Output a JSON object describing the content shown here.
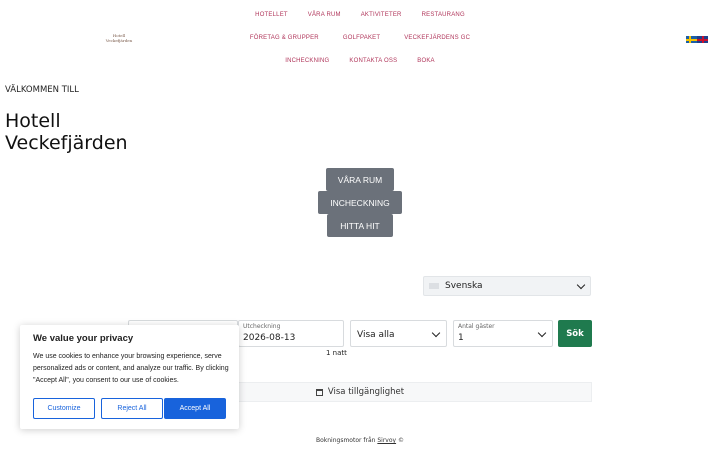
{
  "logo": {
    "line1": "Hotell",
    "line2": "Veckefjärden"
  },
  "nav": {
    "row1": [
      "HOTELLET",
      "VÅRA RUM",
      "AKTIVITETER",
      "RESTAURANG"
    ],
    "row2": [
      "FÖRETAG & GRUPPER",
      "GOLFPAKET",
      "VECKEFJÄRDENS GC"
    ],
    "row3": [
      "INCHECKNING",
      "KONTAKTA OSS",
      "BOKA"
    ]
  },
  "hero": {
    "welcome": "VÄLKOMMEN TILL",
    "title_line1": "Hotell",
    "title_line2": "Veckefjärden",
    "buttons": [
      "VÅRA RUM",
      "INCHECKNING",
      "HITTA HIT"
    ]
  },
  "booking": {
    "language": "Svenska",
    "checkout_label": "Utcheckning",
    "checkout_value": "2026-08-13",
    "room_filter": "Visa alla",
    "guests_label": "Antal gäster",
    "guests_value": "1",
    "search_label": "Sök",
    "nights": "1 natt",
    "availability_label": "Visa tillgänglighet"
  },
  "footer": {
    "prefix": "Bokningsmotor från",
    "link": "Sirvoy",
    "suffix": "©"
  },
  "cookie": {
    "title": "We value your privacy",
    "body": "We use cookies to enhance your browsing experience, serve personalized ads or content, and analyze our traffic. By clicking \"Accept All\", you consent to our use of cookies.",
    "customize": "Customize",
    "reject": "Reject All",
    "accept": "Accept All"
  },
  "colors": {
    "nav": "#b0355a",
    "button_dark": "#6b717a",
    "search": "#1f7a4e",
    "cookie_accent": "#1863dc"
  },
  "icons": [
    "sweden-flag-icon",
    "uk-flag-icon",
    "chevron-down-icon",
    "calendar-icon"
  ]
}
